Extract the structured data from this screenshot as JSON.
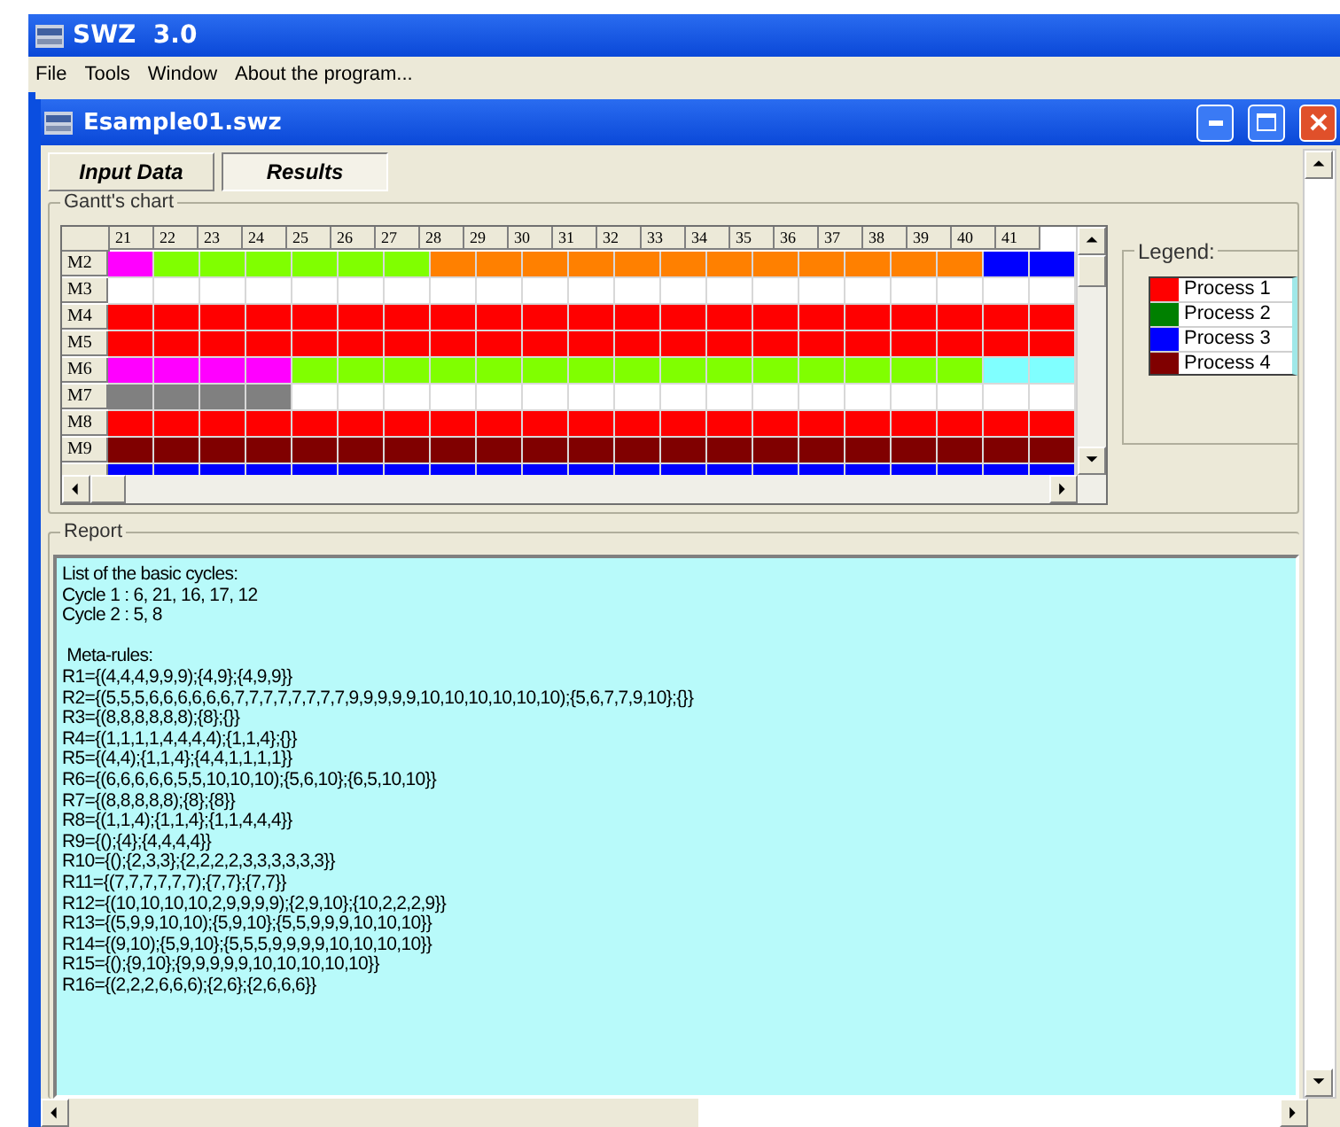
{
  "app": {
    "title": "SWZ  3.0"
  },
  "menu": [
    {
      "label": "File"
    },
    {
      "label": "Tools"
    },
    {
      "label": "Window"
    },
    {
      "label": "About the program..."
    }
  ],
  "document": {
    "title": "Esample01.swz"
  },
  "tabs": [
    {
      "label": "Input Data",
      "selected": false
    },
    {
      "label": "Results",
      "selected": true
    }
  ],
  "gantt": {
    "title": "Gantt's chart",
    "columns": [
      "21",
      "22",
      "23",
      "24",
      "25",
      "26",
      "27",
      "28",
      "29",
      "30",
      "31",
      "32",
      "33",
      "34",
      "35",
      "36",
      "37",
      "38",
      "39",
      "40",
      "41"
    ],
    "rows": [
      {
        "label": "M2",
        "cells": [
          {
            "color": "#ff00ff"
          },
          {
            "color": "#80ff00"
          },
          {
            "color": "#80ff00"
          },
          {
            "color": "#80ff00"
          },
          {
            "color": "#80ff00"
          },
          {
            "color": "#80ff00"
          },
          {
            "color": "#80ff00"
          },
          {
            "color": "#ff8000"
          },
          {
            "color": "#ff8000"
          },
          {
            "color": "#ff8000"
          },
          {
            "color": "#ff8000"
          },
          {
            "color": "#ff8000"
          },
          {
            "color": "#ff8000"
          },
          {
            "color": "#ff8000"
          },
          {
            "color": "#ff8000"
          },
          {
            "color": "#ff8000"
          },
          {
            "color": "#ff8000"
          },
          {
            "color": "#ff8000"
          },
          {
            "color": "#ff8000"
          },
          {
            "color": "#0000ff"
          },
          {
            "color": "#0000ff"
          }
        ]
      },
      {
        "label": "M3",
        "cells": [
          {
            "color": "#ffffff"
          },
          {
            "color": "#ffffff"
          },
          {
            "color": "#ffffff"
          },
          {
            "color": "#ffffff"
          },
          {
            "color": "#ffffff"
          },
          {
            "color": "#ffffff"
          },
          {
            "color": "#ffffff"
          },
          {
            "color": "#ffffff"
          },
          {
            "color": "#ffffff"
          },
          {
            "color": "#ffffff"
          },
          {
            "color": "#ffffff"
          },
          {
            "color": "#ffffff"
          },
          {
            "color": "#ffffff"
          },
          {
            "color": "#ffffff"
          },
          {
            "color": "#ffffff"
          },
          {
            "color": "#ffffff"
          },
          {
            "color": "#ffffff"
          },
          {
            "color": "#ffffff"
          },
          {
            "color": "#ffffff"
          },
          {
            "color": "#ffffff"
          },
          {
            "color": "#ffffff"
          }
        ]
      },
      {
        "label": "M4",
        "cells": [
          {
            "color": "#ff0000"
          },
          {
            "color": "#ff0000"
          },
          {
            "color": "#ff0000"
          },
          {
            "color": "#ff0000"
          },
          {
            "color": "#ff0000"
          },
          {
            "color": "#ff0000"
          },
          {
            "color": "#ff0000"
          },
          {
            "color": "#ff0000"
          },
          {
            "color": "#ff0000"
          },
          {
            "color": "#ff0000"
          },
          {
            "color": "#ff0000"
          },
          {
            "color": "#ff0000"
          },
          {
            "color": "#ff0000"
          },
          {
            "color": "#ff0000"
          },
          {
            "color": "#ff0000"
          },
          {
            "color": "#ff0000"
          },
          {
            "color": "#ff0000"
          },
          {
            "color": "#ff0000"
          },
          {
            "color": "#ff0000"
          },
          {
            "color": "#ff0000"
          },
          {
            "color": "#ff0000"
          }
        ]
      },
      {
        "label": "M5",
        "cells": [
          {
            "color": "#ff0000"
          },
          {
            "color": "#ff0000"
          },
          {
            "color": "#ff0000"
          },
          {
            "color": "#ff0000"
          },
          {
            "color": "#ff0000"
          },
          {
            "color": "#ff0000"
          },
          {
            "color": "#ff0000"
          },
          {
            "color": "#ff0000"
          },
          {
            "color": "#ff0000"
          },
          {
            "color": "#ff0000"
          },
          {
            "color": "#ff0000"
          },
          {
            "color": "#ff0000"
          },
          {
            "color": "#ff0000"
          },
          {
            "color": "#ff0000"
          },
          {
            "color": "#ff0000"
          },
          {
            "color": "#ff0000"
          },
          {
            "color": "#ff0000"
          },
          {
            "color": "#ff0000"
          },
          {
            "color": "#ff0000"
          },
          {
            "color": "#ff0000"
          },
          {
            "color": "#ff0000"
          }
        ]
      },
      {
        "label": "M6",
        "cells": [
          {
            "color": "#ff00ff"
          },
          {
            "color": "#ff00ff"
          },
          {
            "color": "#ff00ff"
          },
          {
            "color": "#ff00ff"
          },
          {
            "color": "#80ff00"
          },
          {
            "color": "#80ff00"
          },
          {
            "color": "#80ff00"
          },
          {
            "color": "#80ff00"
          },
          {
            "color": "#80ff00"
          },
          {
            "color": "#80ff00"
          },
          {
            "color": "#80ff00"
          },
          {
            "color": "#80ff00"
          },
          {
            "color": "#80ff00"
          },
          {
            "color": "#80ff00"
          },
          {
            "color": "#80ff00"
          },
          {
            "color": "#80ff00"
          },
          {
            "color": "#80ff00"
          },
          {
            "color": "#80ff00"
          },
          {
            "color": "#80ff00"
          },
          {
            "color": "#80ffff"
          },
          {
            "color": "#80ffff"
          }
        ]
      },
      {
        "label": "M7",
        "cells": [
          {
            "color": "#808080"
          },
          {
            "color": "#808080"
          },
          {
            "color": "#808080"
          },
          {
            "color": "#808080"
          },
          {
            "color": "#ffffff"
          },
          {
            "color": "#ffffff"
          },
          {
            "color": "#ffffff"
          },
          {
            "color": "#ffffff"
          },
          {
            "color": "#ffffff"
          },
          {
            "color": "#ffffff"
          },
          {
            "color": "#ffffff"
          },
          {
            "color": "#ffffff"
          },
          {
            "color": "#ffffff"
          },
          {
            "color": "#ffffff"
          },
          {
            "color": "#ffffff"
          },
          {
            "color": "#ffffff"
          },
          {
            "color": "#ffffff"
          },
          {
            "color": "#ffffff"
          },
          {
            "color": "#ffffff"
          },
          {
            "color": "#ffffff"
          },
          {
            "color": "#ffffff"
          }
        ]
      },
      {
        "label": "M8",
        "cells": [
          {
            "color": "#ff0000"
          },
          {
            "color": "#ff0000"
          },
          {
            "color": "#ff0000"
          },
          {
            "color": "#ff0000"
          },
          {
            "color": "#ff0000"
          },
          {
            "color": "#ff0000"
          },
          {
            "color": "#ff0000"
          },
          {
            "color": "#ff0000"
          },
          {
            "color": "#ff0000"
          },
          {
            "color": "#ff0000"
          },
          {
            "color": "#ff0000"
          },
          {
            "color": "#ff0000"
          },
          {
            "color": "#ff0000"
          },
          {
            "color": "#ff0000"
          },
          {
            "color": "#ff0000"
          },
          {
            "color": "#ff0000"
          },
          {
            "color": "#ff0000"
          },
          {
            "color": "#ff0000"
          },
          {
            "color": "#ff0000"
          },
          {
            "color": "#ff0000"
          },
          {
            "color": "#ff0000"
          }
        ]
      },
      {
        "label": "M9",
        "cells": [
          {
            "color": "#800000"
          },
          {
            "color": "#800000"
          },
          {
            "color": "#800000"
          },
          {
            "color": "#800000"
          },
          {
            "color": "#800000"
          },
          {
            "color": "#800000"
          },
          {
            "color": "#800000"
          },
          {
            "color": "#800000"
          },
          {
            "color": "#800000"
          },
          {
            "color": "#800000"
          },
          {
            "color": "#800000"
          },
          {
            "color": "#800000"
          },
          {
            "color": "#800000"
          },
          {
            "color": "#800000"
          },
          {
            "color": "#800000"
          },
          {
            "color": "#800000"
          },
          {
            "color": "#800000"
          },
          {
            "color": "#800000"
          },
          {
            "color": "#800000"
          },
          {
            "color": "#800000"
          },
          {
            "color": "#800000"
          }
        ]
      },
      {
        "cells": [
          {
            "color": "#0000ff"
          },
          {
            "color": "#0000ff"
          },
          {
            "color": "#0000ff"
          },
          {
            "color": "#0000ff"
          },
          {
            "color": "#0000ff"
          },
          {
            "color": "#0000ff"
          },
          {
            "color": "#0000ff"
          },
          {
            "color": "#0000ff"
          },
          {
            "color": "#0000ff"
          },
          {
            "color": "#0000ff"
          },
          {
            "color": "#0000ff"
          },
          {
            "color": "#0000ff"
          },
          {
            "color": "#0000ff"
          },
          {
            "color": "#0000ff"
          },
          {
            "color": "#0000ff"
          },
          {
            "color": "#0000ff"
          },
          {
            "color": "#0000ff"
          },
          {
            "color": "#0000ff"
          },
          {
            "color": "#0000ff"
          },
          {
            "color": "#0000ff"
          },
          {
            "color": "#0000ff"
          }
        ]
      }
    ]
  },
  "legend": {
    "title": "Legend:",
    "items": [
      {
        "label": "Process 1",
        "color": "#ff0000"
      },
      {
        "label": "Process 2",
        "color": "#008000"
      },
      {
        "label": "Process 3",
        "color": "#0000ff"
      },
      {
        "label": "Process 4",
        "color": "#800000"
      }
    ]
  },
  "report": {
    "title": "Report",
    "sections": [
      {
        "lines": [
          "List of the basic cycles:",
          "Cycle 1 : 6, 21, 16, 17, 12",
          "Cycle 2 : 5, 8"
        ]
      },
      {
        "lines": [
          " Meta-rules:",
          "R1={(4,4,4,9,9,9);{4,9};{4,9,9}}",
          "R2={(5,5,5,6,6,6,6,6,6,7,7,7,7,7,7,7,7,9,9,9,9,9,10,10,10,10,10,10);{5,6,7,7,9,10};{}}",
          "R3={(8,8,8,8,8,8);{8};{}}",
          "R4={(1,1,1,1,4,4,4,4);{1,1,4};{}}",
          "R5={(4,4);{1,1,4};{4,4,1,1,1,1}}",
          "R6={(6,6,6,6,6,5,5,10,10,10);{5,6,10};{6,5,10,10}}",
          "R7={(8,8,8,8,8);{8};{8}}",
          "R8={(1,1,4);{1,1,4};{1,1,4,4,4}}",
          "R9={();{4};{4,4,4,4}}",
          "R10={();{2,3,3};{2,2,2,2,3,3,3,3,3,3}}",
          "R11={(7,7,7,7,7,7);{7,7};{7,7}}",
          "R12={(10,10,10,10,2,9,9,9,9);{2,9,10};{10,2,2,2,9}}",
          "R13={(5,9,9,10,10);{5,9,10};{5,5,9,9,9,10,10,10}}",
          "R14={(9,10);{5,9,10};{5,5,5,9,9,9,9,10,10,10,10}}",
          "R15={();{9,10};{9,9,9,9,9,10,10,10,10,10}}",
          "R16={(2,2,2,6,6,6);{2,6};{2,6,6,6}}"
        ]
      }
    ]
  }
}
